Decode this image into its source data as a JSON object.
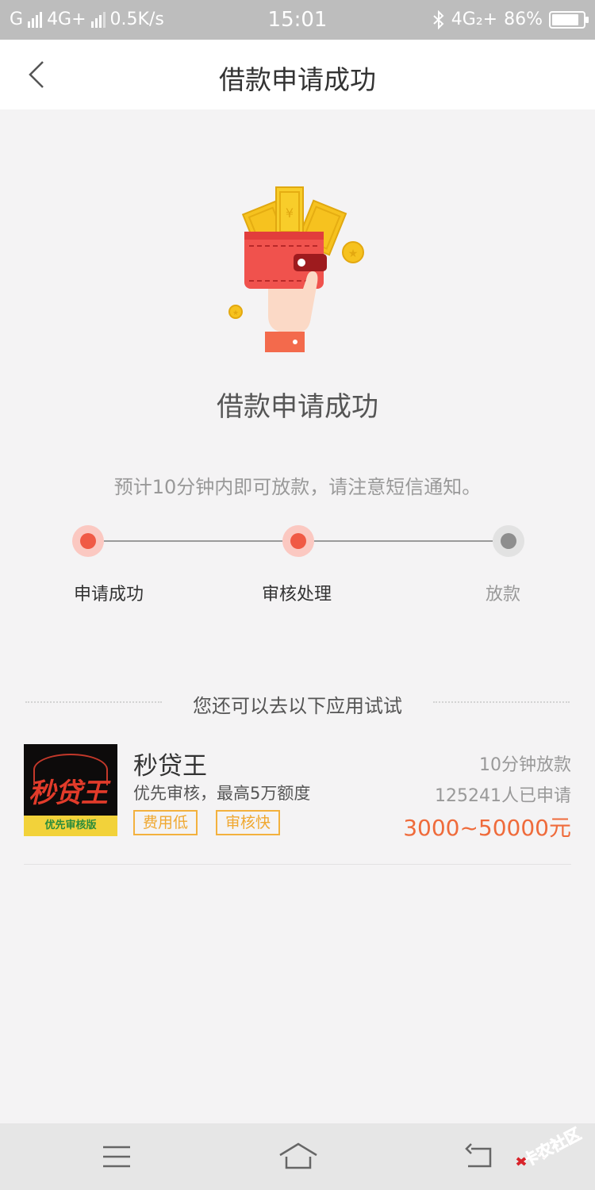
{
  "status_bar": {
    "carrier1": "G",
    "network": "4G+",
    "speed": "0.5K/s",
    "time": "15:01",
    "net_right": "4G₂+",
    "battery": "86%",
    "battery_level": 0.86
  },
  "nav": {
    "title": "借款申请成功",
    "back_icon": "chevron-left-icon"
  },
  "hero": {
    "icon": "wallet-money-hand-icon",
    "title": "借款申请成功",
    "subtitle": "预计10分钟内即可放款，请注意短信通知。"
  },
  "steps": [
    {
      "label": "申请成功",
      "state": "done"
    },
    {
      "label": "审核处理",
      "state": "done"
    },
    {
      "label": "放款",
      "state": "pending"
    }
  ],
  "recommend": {
    "header": "您还可以去以下应用试试",
    "apps": [
      {
        "logo_text": "秒贷王",
        "logo_band": "优先审核版",
        "name": "秒贷王",
        "desc": "优先审核，最高5万额度",
        "tags": [
          "费用低",
          "审核快"
        ],
        "speed": "10分钟放款",
        "applicants": "125241人已申请",
        "range": "3000~50000元"
      }
    ]
  },
  "colors": {
    "accent": "#f05a45",
    "amount": "#ef6b3b",
    "tag": "#f3b13e"
  },
  "system_nav": {
    "menu_icon": "menu-icon",
    "home_icon": "home-icon",
    "back_icon": "return-icon"
  },
  "watermark": {
    "text": "卡农社区"
  }
}
